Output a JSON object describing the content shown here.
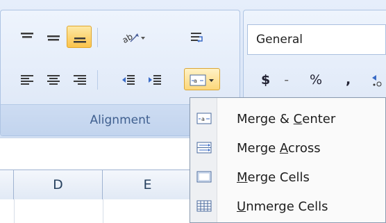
{
  "alignment_group": {
    "label": "Alignment"
  },
  "number_group": {
    "format_value": "General",
    "currency_label": "$",
    "currency_arrow": "-",
    "percent_label": "%",
    "comma_label": ","
  },
  "merge_menu": {
    "items": [
      {
        "pre": "Merge & ",
        "key": "C",
        "post": "enter",
        "icon": "merge-center-icon"
      },
      {
        "pre": "Merge ",
        "key": "A",
        "post": "cross",
        "icon": "merge-across-icon"
      },
      {
        "pre": "",
        "key": "M",
        "post": "erge Cells",
        "icon": "merge-cells-icon"
      },
      {
        "pre": "",
        "key": "U",
        "post": "nmerge Cells",
        "icon": "unmerge-cells-icon"
      }
    ]
  },
  "sheet": {
    "columns": [
      "D",
      "E"
    ]
  },
  "colors": {
    "ribbon_bg": "#dce7f7",
    "active_button": "#fbc34a",
    "group_label_text": "#3f5f8f",
    "header_text": "#27415f"
  }
}
